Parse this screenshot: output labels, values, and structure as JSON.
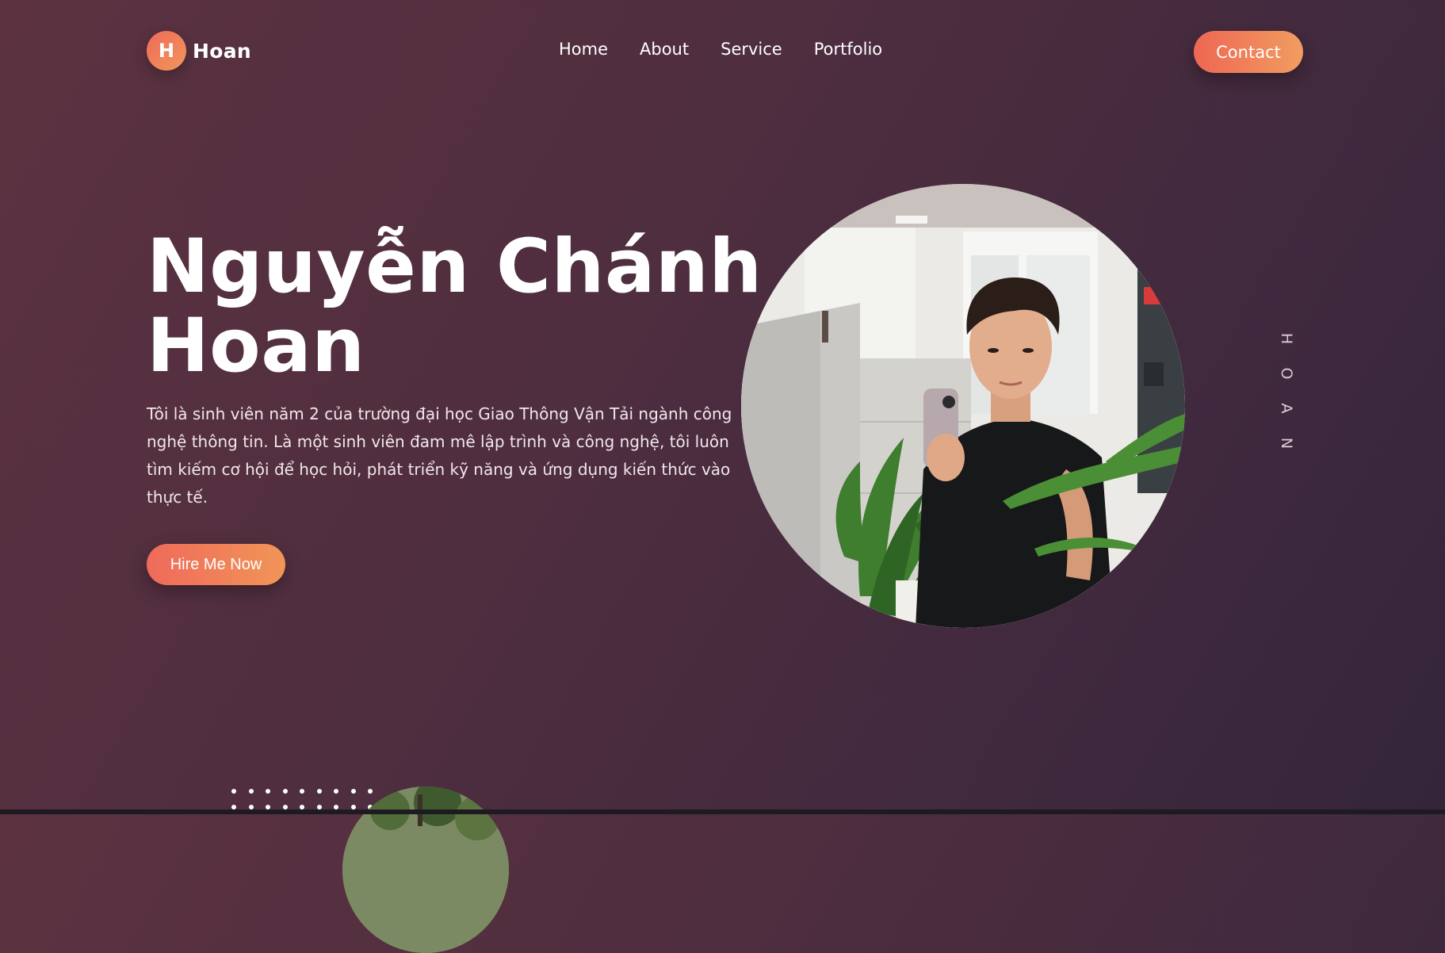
{
  "header": {
    "logo_letter": "H",
    "logo_text": "Hoan",
    "nav": [
      "Home",
      "About",
      "Service",
      "Portfolio"
    ],
    "contact_label": "Contact"
  },
  "hero": {
    "title_line1": "Nguyễn Chánh",
    "title_line2": "Hoan",
    "description": "Tôi là sinh viên năm 2 của trường đại học Giao Thông Vận Tải ngành công nghệ thông tin. Là một sinh viên đam mê lập trình và công nghệ, tôi luôn tìm kiếm cơ hội để học hỏi, phát triển kỹ năng và ứng dụng kiến thức vào thực tế.",
    "cta_label": "Hire Me Now"
  },
  "side_letters": [
    "H",
    "O",
    "A",
    "N"
  ],
  "colors": {
    "accent_start": "#ee6753",
    "accent_end": "#f19d60",
    "background": "#4f2e3f"
  }
}
